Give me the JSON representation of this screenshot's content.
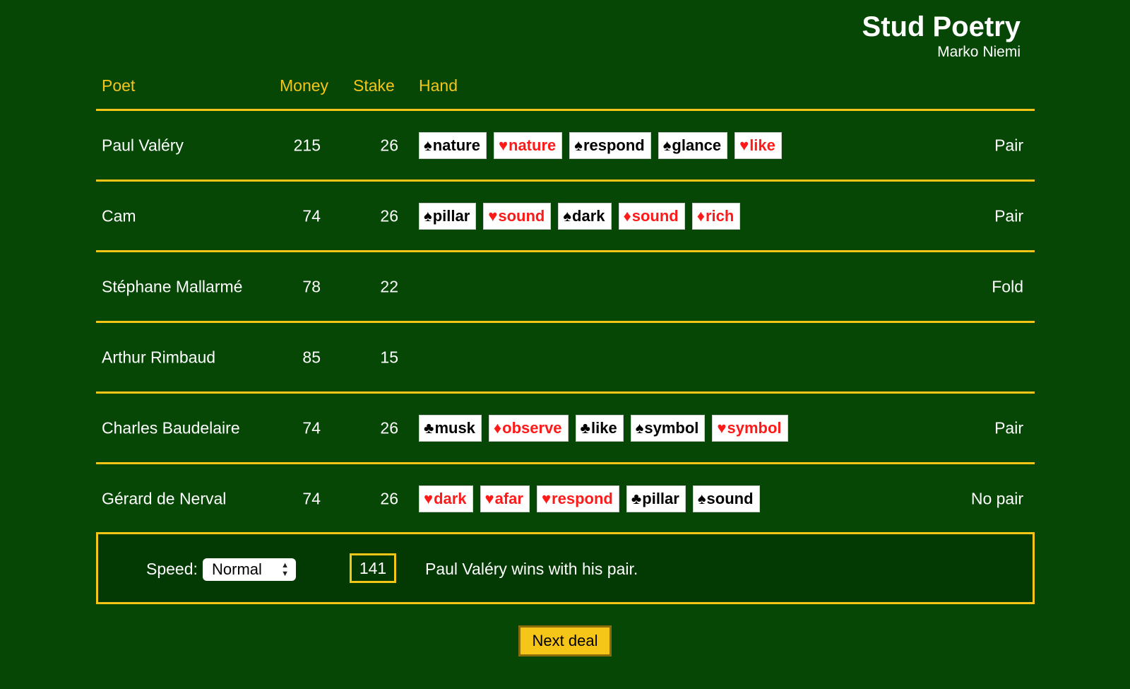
{
  "header": {
    "title": "Stud Poetry",
    "author": "Marko Niemi"
  },
  "columns": {
    "poet": "Poet",
    "money": "Money",
    "stake": "Stake",
    "hand": "Hand"
  },
  "players": [
    {
      "name": "Paul Valéry",
      "money": "215",
      "stake": "26",
      "result": "Pair",
      "cards": [
        {
          "suit": "♠",
          "word": "nature",
          "color": "black"
        },
        {
          "suit": "♥",
          "word": "nature",
          "color": "red"
        },
        {
          "suit": "♠",
          "word": "respond",
          "color": "black"
        },
        {
          "suit": "♠",
          "word": "glance",
          "color": "black"
        },
        {
          "suit": "♥",
          "word": "like",
          "color": "red"
        }
      ]
    },
    {
      "name": "Cam",
      "money": "74",
      "stake": "26",
      "result": "Pair",
      "cards": [
        {
          "suit": "♠",
          "word": "pillar",
          "color": "black"
        },
        {
          "suit": "♥",
          "word": "sound",
          "color": "red"
        },
        {
          "suit": "♠",
          "word": "dark",
          "color": "black"
        },
        {
          "suit": "♦",
          "word": "sound",
          "color": "red"
        },
        {
          "suit": "♦",
          "word": "rich",
          "color": "red"
        }
      ]
    },
    {
      "name": "Stéphane Mallarmé",
      "money": "78",
      "stake": "22",
      "result": "Fold",
      "cards": []
    },
    {
      "name": "Arthur Rimbaud",
      "money": "85",
      "stake": "15",
      "result": "",
      "cards": []
    },
    {
      "name": "Charles Baudelaire",
      "money": "74",
      "stake": "26",
      "result": "Pair",
      "cards": [
        {
          "suit": "♣",
          "word": "musk",
          "color": "black"
        },
        {
          "suit": "♦",
          "word": "observe",
          "color": "red"
        },
        {
          "suit": "♣",
          "word": "like",
          "color": "black"
        },
        {
          "suit": "♠",
          "word": "symbol",
          "color": "black"
        },
        {
          "suit": "♥",
          "word": "symbol",
          "color": "red"
        }
      ]
    },
    {
      "name": "Gérard de Nerval",
      "money": "74",
      "stake": "26",
      "result": "No pair",
      "cards": [
        {
          "suit": "♥",
          "word": "dark",
          "color": "red"
        },
        {
          "suit": "♥",
          "word": "afar",
          "color": "red"
        },
        {
          "suit": "♥",
          "word": "respond",
          "color": "red"
        },
        {
          "suit": "♣",
          "word": "pillar",
          "color": "black"
        },
        {
          "suit": "♠",
          "word": "sound",
          "color": "black"
        }
      ]
    }
  ],
  "controls": {
    "speed_label": "Speed:",
    "speed_value": "Normal",
    "pot": "141",
    "status": "Paul Valéry wins with his pair."
  },
  "next_button": "Next deal",
  "colors": {
    "background": "#064706",
    "accent": "#f5c518",
    "red_suit": "#ff1a1a"
  }
}
